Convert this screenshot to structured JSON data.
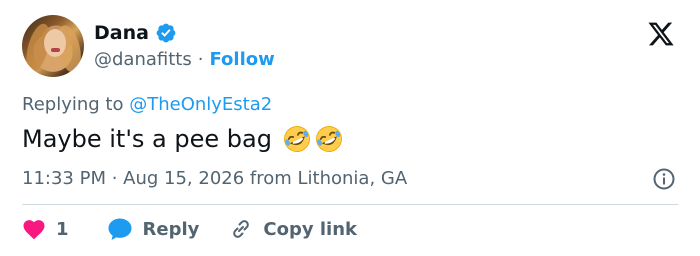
{
  "author": {
    "name": "Dana",
    "handle": "@danafitts",
    "separator": "·",
    "follow_label": "Follow"
  },
  "tweet": {
    "replying_prefix": "Replying to",
    "replying_to": "@TheOnlyEsta2",
    "text": "Maybe it's a pee bag",
    "emojis": [
      "rolling-on-floor-laughing",
      "rolling-on-floor-laughing"
    ],
    "timestamp": "11:33 PM · Aug 15, 2026 from Lithonia, GA"
  },
  "actions": {
    "like_count": "1",
    "reply_label": "Reply",
    "copy_link_label": "Copy link"
  },
  "colors": {
    "accent": "#1d9bf0",
    "like": "#f91880",
    "text": "#0f1419",
    "muted": "#536471",
    "divider": "#cfd9de"
  }
}
